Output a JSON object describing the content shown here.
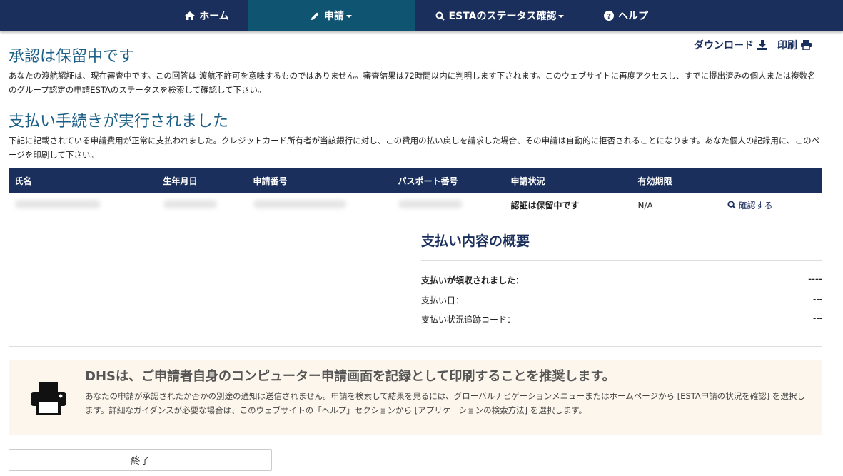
{
  "nav": {
    "home": "ホーム",
    "apply": "申請",
    "status": "ESTAのステータス確認",
    "help": "ヘルプ"
  },
  "actions": {
    "download": "ダウンロード",
    "print": "印刷"
  },
  "pending": {
    "title": "承認は保留中です",
    "body": "あなたの渡航認証は、現在審査中です。この回答は 渡航不許可を意味するものではありません。審査結果は72時間以内に判明します下されます。このウェブサイトに再度アクセスし、すでに提出済みの個人または複数名のグループ認定の申請ESTAのステータスを検索して確認して下さい。"
  },
  "payment": {
    "title": "支払い手続きが実行されました",
    "body": "下記に記載されている申請費用が正常に支払われました。クレジットカード所有者が当該銀行に対し、この費用の払い戻しを請求した場合、その申請は自動的に拒否されることになります。あなた個人の記録用に、このページを印刷して下さい。"
  },
  "table": {
    "headers": [
      "氏名",
      "生年月日",
      "申請番号",
      "パスポート番号",
      "申請状況",
      "有効期限",
      ""
    ],
    "row": {
      "status": "認証は保留中です",
      "expiry": "N/A",
      "action": "確認する"
    }
  },
  "summary": {
    "title": "支払い内容の概要",
    "rows": [
      {
        "label": "支払いが領収されました：",
        "value": "----"
      },
      {
        "label": "支払い日：",
        "value": "---"
      },
      {
        "label": "支払い状況追跡コード：",
        "value": "---"
      }
    ]
  },
  "notice": {
    "title": "DHSは、ご申請者自身のコンピューター申請画面を記録として印刷することを推奨します。",
    "body": "あなたの申請が承認されたか否かの別途の通知は送信されません。申請を検索して結果を見るには、グローバルナビゲーションメニューまたはホームページから [ESTA申請の状況を確認] を選択します。詳細なガイダンスが必要な場合は、このウェブサイトの「ヘルプ」セクションから [アプリケーションの検索方法] を選択します。"
  },
  "exit": "終了"
}
